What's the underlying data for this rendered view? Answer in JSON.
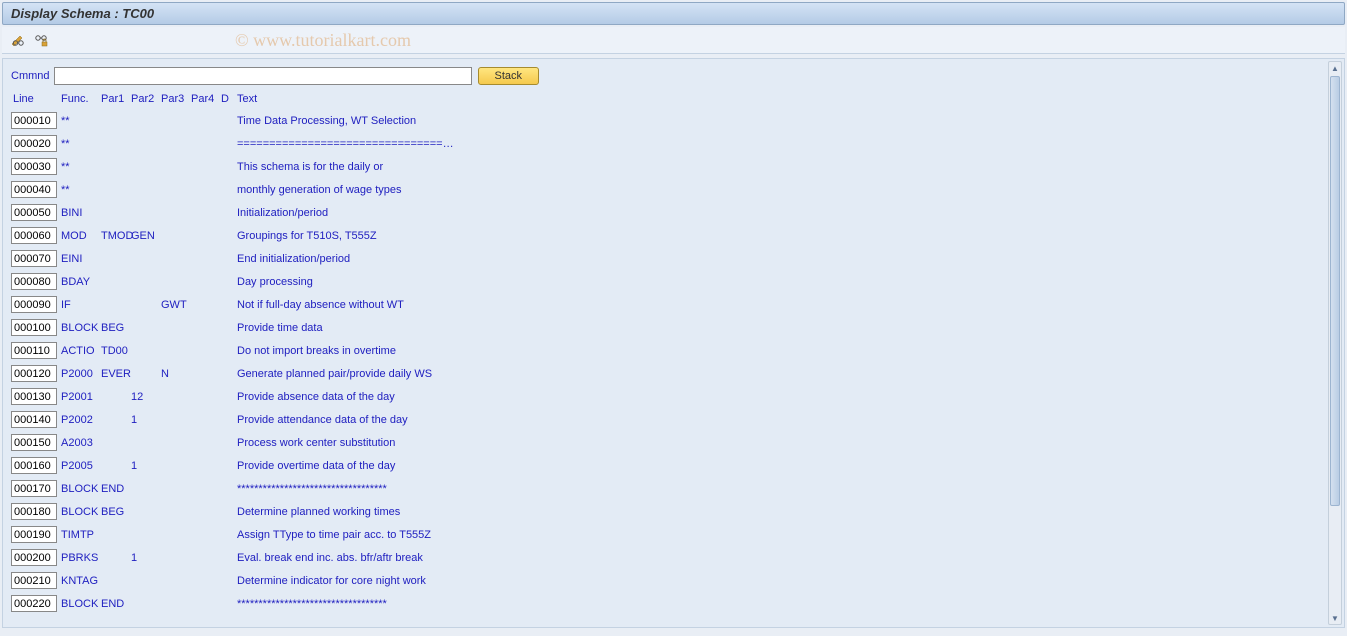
{
  "title": "Display Schema : TC00",
  "watermark": "© www.tutorialkart.com",
  "toolbar": {
    "icon1": "pencil-glasses-icon",
    "icon2": "glasses-lock-icon"
  },
  "cmd": {
    "label": "Cmmnd",
    "value": "",
    "stack_label": "Stack"
  },
  "headers": {
    "line": "Line",
    "func": "Func.",
    "par1": "Par1",
    "par2": "Par2",
    "par3": "Par3",
    "par4": "Par4",
    "d": "D",
    "text": "Text"
  },
  "rows": [
    {
      "line": "000010",
      "func": "**",
      "par1": "",
      "par2": "",
      "par3": "",
      "par4": "",
      "d": "",
      "text": "Time Data Processing, WT Selection"
    },
    {
      "line": "000020",
      "func": "**",
      "par1": "",
      "par2": "",
      "par3": "",
      "par4": "",
      "d": "",
      "text": "================================…"
    },
    {
      "line": "000030",
      "func": "**",
      "par1": "",
      "par2": "",
      "par3": "",
      "par4": "",
      "d": "",
      "text": "This schema is for the daily or"
    },
    {
      "line": "000040",
      "func": "**",
      "par1": "",
      "par2": "",
      "par3": "",
      "par4": "",
      "d": "",
      "text": "monthly generation of wage types"
    },
    {
      "line": "000050",
      "func": "BINI",
      "par1": "",
      "par2": "",
      "par3": "",
      "par4": "",
      "d": "",
      "text": "Initialization/period"
    },
    {
      "line": "000060",
      "func": "MOD",
      "par1": "TMOD",
      "par2": "GEN",
      "par3": "",
      "par4": "",
      "d": "",
      "text": "Groupings for T510S, T555Z"
    },
    {
      "line": "000070",
      "func": "EINI",
      "par1": "",
      "par2": "",
      "par3": "",
      "par4": "",
      "d": "",
      "text": "End initialization/period"
    },
    {
      "line": "000080",
      "func": "BDAY",
      "par1": "",
      "par2": "",
      "par3": "",
      "par4": "",
      "d": "",
      "text": "Day processing"
    },
    {
      "line": "000090",
      "func": "IF",
      "par1": "",
      "par2": "",
      "par3": "GWT",
      "par4": "",
      "d": "",
      "text": "Not if full-day absence without WT"
    },
    {
      "line": "000100",
      "func": "BLOCK",
      "par1": "BEG",
      "par2": "",
      "par3": "",
      "par4": "",
      "d": "",
      "text": "Provide time data"
    },
    {
      "line": "000110",
      "func": "ACTIO",
      "par1": "TD00",
      "par2": "",
      "par3": "",
      "par4": "",
      "d": "",
      "text": "Do not import breaks in overtime"
    },
    {
      "line": "000120",
      "func": "P2000",
      "par1": "EVER",
      "par2": "",
      "par3": "N",
      "par4": "",
      "d": "",
      "text": "Generate planned pair/provide daily WS"
    },
    {
      "line": "000130",
      "func": "P2001",
      "par1": "",
      "par2": "12",
      "par3": "",
      "par4": "",
      "d": "",
      "text": "Provide absence data of the day"
    },
    {
      "line": "000140",
      "func": "P2002",
      "par1": "",
      "par2": "1",
      "par3": "",
      "par4": "",
      "d": "",
      "text": "Provide attendance data of the day"
    },
    {
      "line": "000150",
      "func": "A2003",
      "par1": "",
      "par2": "",
      "par3": "",
      "par4": "",
      "d": "",
      "text": "Process work center substitution"
    },
    {
      "line": "000160",
      "func": "P2005",
      "par1": "",
      "par2": "1",
      "par3": "",
      "par4": "",
      "d": "",
      "text": "Provide overtime data of the day"
    },
    {
      "line": "000170",
      "func": "BLOCK",
      "par1": "END",
      "par2": "",
      "par3": "",
      "par4": "",
      "d": "",
      "text": "***********************************"
    },
    {
      "line": "000180",
      "func": "BLOCK",
      "par1": "BEG",
      "par2": "",
      "par3": "",
      "par4": "",
      "d": "",
      "text": "Determine planned working times"
    },
    {
      "line": "000190",
      "func": "TIMTP",
      "par1": "",
      "par2": "",
      "par3": "",
      "par4": "",
      "d": "",
      "text": "Assign TType to time pair acc. to T555Z"
    },
    {
      "line": "000200",
      "func": "PBRKS",
      "par1": "",
      "par2": "1",
      "par3": "",
      "par4": "",
      "d": "",
      "text": "Eval. break end inc. abs. bfr/aftr break"
    },
    {
      "line": "000210",
      "func": "KNTAG",
      "par1": "",
      "par2": "",
      "par3": "",
      "par4": "",
      "d": "",
      "text": "Determine indicator for core night work"
    },
    {
      "line": "000220",
      "func": "BLOCK",
      "par1": "END",
      "par2": "",
      "par3": "",
      "par4": "",
      "d": "",
      "text": "***********************************"
    }
  ]
}
